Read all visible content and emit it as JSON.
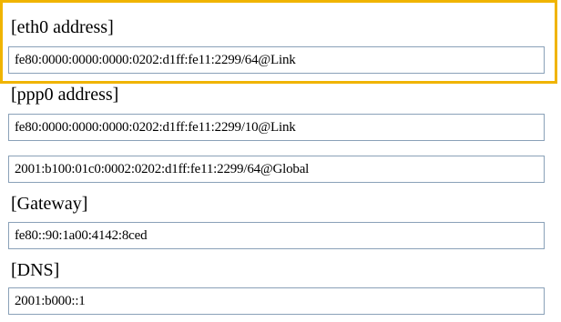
{
  "sections": [
    {
      "label": "[eth0 address]",
      "fields": [
        "fe80:0000:0000:0000:0202:d1ff:fe11:2299/64@Link"
      ]
    },
    {
      "label": "[ppp0 address]",
      "fields": [
        "fe80:0000:0000:0000:0202:d1ff:fe11:2299/10@Link",
        "2001:b100:01c0:0002:0202:d1ff:fe11:2299/64@Global"
      ]
    },
    {
      "label": "[Gateway]",
      "fields": [
        "fe80::90:1a00:4142:8ced"
      ]
    },
    {
      "label": "[DNS]",
      "fields": [
        "2001:b000::1"
      ]
    }
  ],
  "colors": {
    "highlight": "#f0b400",
    "field_border": "#8aa1b8"
  }
}
